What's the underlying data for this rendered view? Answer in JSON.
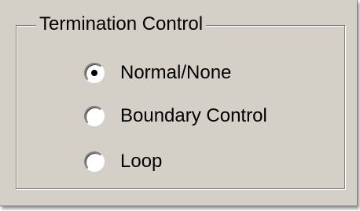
{
  "group": {
    "title": "Termination Control",
    "options": [
      {
        "label": "Normal/None",
        "selected": true
      },
      {
        "label": "Boundary Control",
        "selected": false
      },
      {
        "label": "Loop",
        "selected": false
      }
    ]
  }
}
